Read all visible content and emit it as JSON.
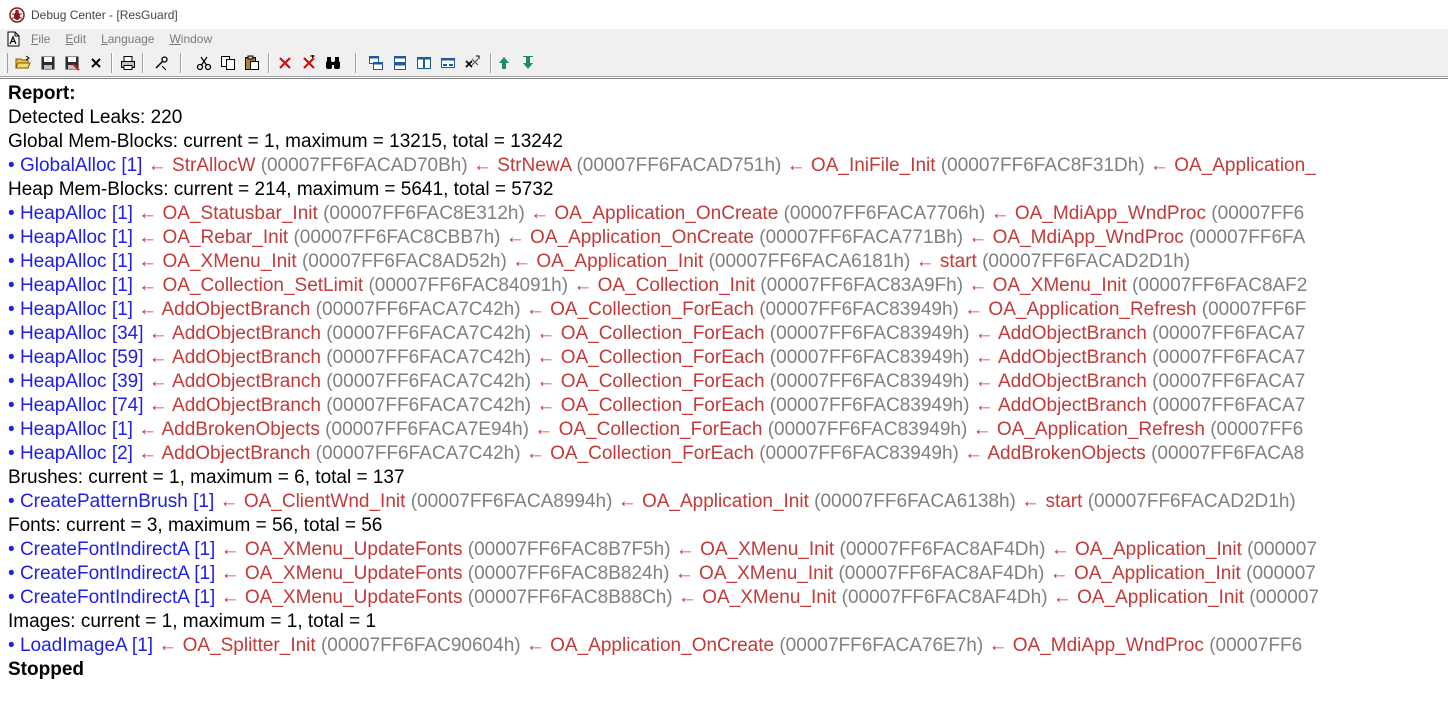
{
  "window": {
    "title": "Debug Center - [ResGuard]"
  },
  "menu": [
    {
      "first": "F",
      "rest": "ile"
    },
    {
      "first": "E",
      "rest": "dit"
    },
    {
      "first": "L",
      "rest": "anguage"
    },
    {
      "first": "W",
      "rest": "indow"
    }
  ],
  "toolbar": {
    "buttons": [
      {
        "icon": "open-folder-icon"
      },
      {
        "icon": "save-icon"
      },
      {
        "icon": "save-as-icon"
      },
      {
        "icon": "close-x-icon"
      },
      {
        "icon": "print-icon"
      },
      {
        "icon": "settings-tool-icon"
      },
      {
        "icon": "cut-icon"
      },
      {
        "icon": "copy-icon"
      },
      {
        "icon": "paste-icon"
      },
      {
        "icon": "delete-icon"
      },
      {
        "icon": "delete-all-icon"
      },
      {
        "icon": "find-icon"
      },
      {
        "icon": "tile-cascade-icon"
      },
      {
        "icon": "tile-horizontal-icon"
      },
      {
        "icon": "tile-vertical-icon"
      },
      {
        "icon": "arrange-icons-icon"
      },
      {
        "icon": "close-all-icon"
      },
      {
        "icon": "arrow-up-icon"
      },
      {
        "icon": "arrow-down-icon"
      }
    ]
  },
  "report": {
    "lines": [
      {
        "type": "heading",
        "text": "Report:"
      },
      {
        "type": "text",
        "text": "Detected Leaks: 220"
      },
      {
        "type": "text",
        "text": "Global Mem-Blocks: current = 1, maximum = 13215, total = 13242"
      },
      {
        "type": "entry",
        "fn": "GlobalAlloc [1]",
        "calls": [
          {
            "name": "StrAllocW",
            "addr": "(00007FF6FACAD70Bh)"
          },
          {
            "name": "StrNewA",
            "addr": "(00007FF6FACAD751h)"
          },
          {
            "name": "OA_IniFile_Init",
            "addr": "(00007FF6FAC8F31Dh)"
          },
          {
            "name": "OA_Application_",
            "addr": ""
          }
        ]
      },
      {
        "type": "text",
        "text": "Heap Mem-Blocks: current = 214, maximum = 5641, total = 5732"
      },
      {
        "type": "entry",
        "fn": "HeapAlloc [1]",
        "calls": [
          {
            "name": "OA_Statusbar_Init",
            "addr": "(00007FF6FAC8E312h)"
          },
          {
            "name": "OA_Application_OnCreate",
            "addr": "(00007FF6FACA7706h)"
          },
          {
            "name": "OA_MdiApp_WndProc",
            "addr": "(00007FF6"
          }
        ]
      },
      {
        "type": "entry",
        "fn": "HeapAlloc [1]",
        "calls": [
          {
            "name": "OA_Rebar_Init",
            "addr": "(00007FF6FAC8CBB7h)"
          },
          {
            "name": "OA_Application_OnCreate",
            "addr": "(00007FF6FACA771Bh)"
          },
          {
            "name": "OA_MdiApp_WndProc",
            "addr": "(00007FF6FA"
          }
        ]
      },
      {
        "type": "entry",
        "fn": "HeapAlloc [1]",
        "calls": [
          {
            "name": "OA_XMenu_Init",
            "addr": "(00007FF6FAC8AD52h)"
          },
          {
            "name": "OA_Application_Init",
            "addr": "(00007FF6FACA6181h)"
          },
          {
            "name": "start",
            "addr": "(00007FF6FACAD2D1h)"
          }
        ]
      },
      {
        "type": "entry",
        "fn": "HeapAlloc [1]",
        "calls": [
          {
            "name": "OA_Collection_SetLimit",
            "addr": "(00007FF6FAC84091h)"
          },
          {
            "name": "OA_Collection_Init",
            "addr": "(00007FF6FAC83A9Fh)"
          },
          {
            "name": "OA_XMenu_Init",
            "addr": "(00007FF6FAC8AF2"
          }
        ]
      },
      {
        "type": "entry",
        "fn": "HeapAlloc [1]",
        "calls": [
          {
            "name": "AddObjectBranch",
            "addr": "(00007FF6FACA7C42h)"
          },
          {
            "name": "OA_Collection_ForEach",
            "addr": "(00007FF6FAC83949h)"
          },
          {
            "name": "OA_Application_Refresh",
            "addr": "(00007FF6F"
          }
        ]
      },
      {
        "type": "entry",
        "fn": "HeapAlloc [34]",
        "calls": [
          {
            "name": "AddObjectBranch",
            "addr": "(00007FF6FACA7C42h)"
          },
          {
            "name": "OA_Collection_ForEach",
            "addr": "(00007FF6FAC83949h)"
          },
          {
            "name": "AddObjectBranch",
            "addr": "(00007FF6FACA7"
          }
        ]
      },
      {
        "type": "entry",
        "fn": "HeapAlloc [59]",
        "calls": [
          {
            "name": "AddObjectBranch",
            "addr": "(00007FF6FACA7C42h)"
          },
          {
            "name": "OA_Collection_ForEach",
            "addr": "(00007FF6FAC83949h)"
          },
          {
            "name": "AddObjectBranch",
            "addr": "(00007FF6FACA7"
          }
        ]
      },
      {
        "type": "entry",
        "fn": "HeapAlloc [39]",
        "calls": [
          {
            "name": "AddObjectBranch",
            "addr": "(00007FF6FACA7C42h)"
          },
          {
            "name": "OA_Collection_ForEach",
            "addr": "(00007FF6FAC83949h)"
          },
          {
            "name": "AddObjectBranch",
            "addr": "(00007FF6FACA7"
          }
        ]
      },
      {
        "type": "entry",
        "fn": "HeapAlloc [74]",
        "calls": [
          {
            "name": "AddObjectBranch",
            "addr": "(00007FF6FACA7C42h)"
          },
          {
            "name": "OA_Collection_ForEach",
            "addr": "(00007FF6FAC83949h)"
          },
          {
            "name": "AddObjectBranch",
            "addr": "(00007FF6FACA7"
          }
        ]
      },
      {
        "type": "entry",
        "fn": "HeapAlloc [1]",
        "calls": [
          {
            "name": "AddBrokenObjects",
            "addr": "(00007FF6FACA7E94h)"
          },
          {
            "name": "OA_Collection_ForEach",
            "addr": "(00007FF6FAC83949h)"
          },
          {
            "name": "OA_Application_Refresh",
            "addr": "(00007FF6"
          }
        ]
      },
      {
        "type": "entry",
        "fn": "HeapAlloc [2]",
        "calls": [
          {
            "name": "AddObjectBranch",
            "addr": "(00007FF6FACA7C42h)"
          },
          {
            "name": "OA_Collection_ForEach",
            "addr": "(00007FF6FAC83949h)"
          },
          {
            "name": "AddBrokenObjects",
            "addr": "(00007FF6FACA8"
          }
        ]
      },
      {
        "type": "text",
        "text": "Brushes: current = 1, maximum = 6, total = 137"
      },
      {
        "type": "entry",
        "fn": "CreatePatternBrush [1]",
        "calls": [
          {
            "name": "OA_ClientWnd_Init",
            "addr": "(00007FF6FACA8994h)"
          },
          {
            "name": "OA_Application_Init",
            "addr": "(00007FF6FACA6138h)"
          },
          {
            "name": "start",
            "addr": "(00007FF6FACAD2D1h)"
          }
        ]
      },
      {
        "type": "text",
        "text": "Fonts: current = 3, maximum = 56, total = 56"
      },
      {
        "type": "entry",
        "fn": "CreateFontIndirectA [1]",
        "calls": [
          {
            "name": "OA_XMenu_UpdateFonts",
            "addr": "(00007FF6FAC8B7F5h)"
          },
          {
            "name": "OA_XMenu_Init",
            "addr": "(00007FF6FAC8AF4Dh)"
          },
          {
            "name": "OA_Application_Init",
            "addr": "(000007"
          }
        ]
      },
      {
        "type": "entry",
        "fn": "CreateFontIndirectA [1]",
        "calls": [
          {
            "name": "OA_XMenu_UpdateFonts",
            "addr": "(00007FF6FAC8B824h)"
          },
          {
            "name": "OA_XMenu_Init",
            "addr": "(00007FF6FAC8AF4Dh)"
          },
          {
            "name": "OA_Application_Init",
            "addr": "(000007"
          }
        ]
      },
      {
        "type": "entry",
        "fn": "CreateFontIndirectA [1]",
        "calls": [
          {
            "name": "OA_XMenu_UpdateFonts",
            "addr": "(00007FF6FAC8B88Ch)"
          },
          {
            "name": "OA_XMenu_Init",
            "addr": "(00007FF6FAC8AF4Dh)"
          },
          {
            "name": "OA_Application_Init",
            "addr": "(000007"
          }
        ]
      },
      {
        "type": "text",
        "text": "Images: current = 1, maximum = 1, total = 1"
      },
      {
        "type": "entry",
        "fn": "LoadImageA [1]",
        "calls": [
          {
            "name": "OA_Splitter_Init",
            "addr": "(00007FF6FAC90604h)"
          },
          {
            "name": "OA_Application_OnCreate",
            "addr": "(00007FF6FACA76E7h)"
          },
          {
            "name": "OA_MdiApp_WndProc",
            "addr": "(00007FF6"
          }
        ]
      },
      {
        "type": "heading",
        "text": "Stopped"
      }
    ]
  }
}
